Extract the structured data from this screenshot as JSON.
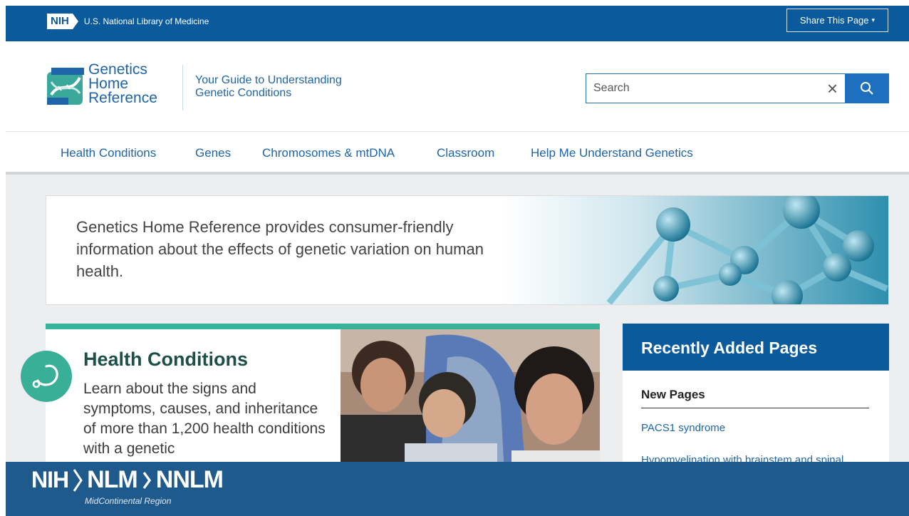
{
  "nihbar": {
    "nih_label": "NIH",
    "org_name": "U.S. National Library of Medicine",
    "share_label": "Share This Page",
    "share_caret": "▾"
  },
  "header": {
    "logo_lines": [
      "Genetics",
      "Home",
      "Reference"
    ],
    "tagline_lines": [
      "Your Guide to Understanding",
      "Genetic Conditions"
    ],
    "search_placeholder": "Search",
    "clear_glyph": "×"
  },
  "nav": {
    "items": [
      "Health Conditions",
      "Genes",
      "Chromosomes & mtDNA",
      "Classroom",
      "Help Me Understand Genetics"
    ]
  },
  "banner": {
    "text": "Genetics Home Reference provides consumer-friendly information about the effects of genetic variation on human health."
  },
  "health_conditions": {
    "title": "Health Conditions",
    "description": "Learn about the signs and symptoms, causes, and inheritance of more than 1,200 health conditions with a genetic"
  },
  "recent": {
    "heading": "Recently Added Pages",
    "subheading": "New Pages",
    "links": [
      "PACS1 syndrome",
      "Hypomyelination with brainstem and spinal"
    ]
  },
  "footer": {
    "nih_label": "NIH",
    "nlm_label": "NLM",
    "nnlm_label": "NNLM",
    "region": "MidContinental Region"
  },
  "colors": {
    "nih_blue": "#0b5a9c",
    "link_blue": "#1e64a8",
    "teal": "#37b39a"
  },
  "icons": {
    "search": "search-icon",
    "clear": "close-icon",
    "stethoscope": "stethoscope-icon",
    "logo": "dna-logo-icon"
  }
}
